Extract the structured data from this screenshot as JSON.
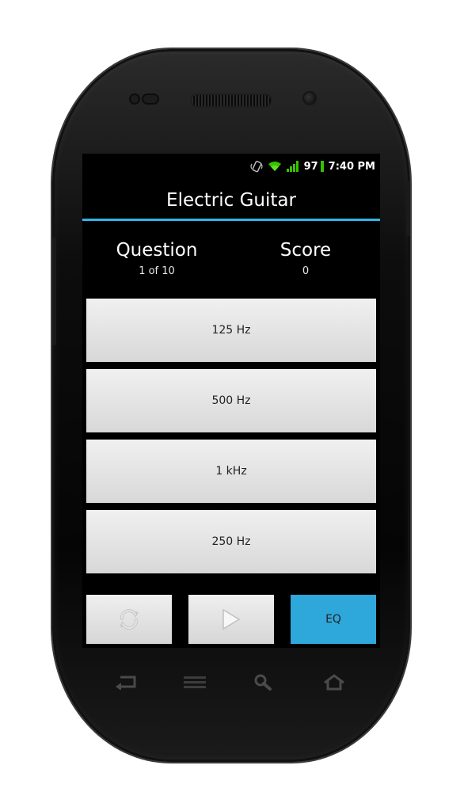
{
  "status_bar": {
    "battery_level": "97",
    "time": "7:40 PM",
    "icons": [
      "vibrate-icon",
      "wifi-icon",
      "signal-icon",
      "battery-icon"
    ],
    "battery_color": "#37c200"
  },
  "action_bar": {
    "title": "Electric Guitar",
    "accent_color": "#33b5e5"
  },
  "stats": {
    "question_label": "Question",
    "question_value": "1 of 10",
    "score_label": "Score",
    "score_value": "0"
  },
  "answers": [
    {
      "label": "125 Hz"
    },
    {
      "label": "500 Hz"
    },
    {
      "label": "1 kHz"
    },
    {
      "label": "250 Hz"
    }
  ],
  "controls": {
    "refresh_icon": "refresh-icon",
    "play_icon": "play-icon",
    "eq_label": "EQ",
    "eq_color": "#2ea7da"
  },
  "nav_keys": [
    "back-icon",
    "menu-icon",
    "search-icon",
    "home-icon"
  ]
}
